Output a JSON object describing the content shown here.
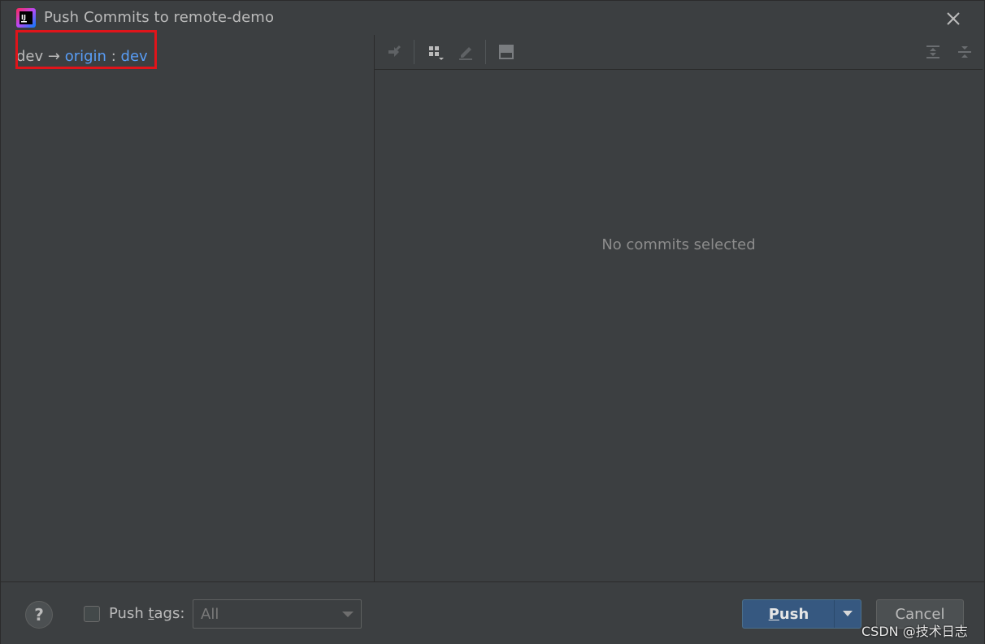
{
  "window": {
    "title": "Push Commits to remote-demo",
    "app_icon_text": "IJ"
  },
  "left_panel": {
    "branch": {
      "local": "dev",
      "arrow": "→",
      "remote": "origin",
      "separator": ":",
      "remote_branch": "dev"
    }
  },
  "right_panel": {
    "toolbar_icons": [
      "cherry-pick-icon",
      "group-by-icon",
      "edit-icon",
      "preview-icon",
      "expand-all-icon",
      "collapse-all-icon"
    ],
    "empty_text": "No commits selected"
  },
  "bottom": {
    "help": "?",
    "push_tags_pre": "Push ",
    "push_tags_mnemonic": "t",
    "push_tags_post": "ags:",
    "tags_select_value": "All",
    "push_mnemonic": "P",
    "push_rest": "ush",
    "cancel_label": "Cancel"
  },
  "watermark": "CSDN @技术日志",
  "colors": {
    "background": "#3c3f41",
    "link": "#589df6",
    "highlight": "#e0141a",
    "primary_button": "#365880"
  }
}
